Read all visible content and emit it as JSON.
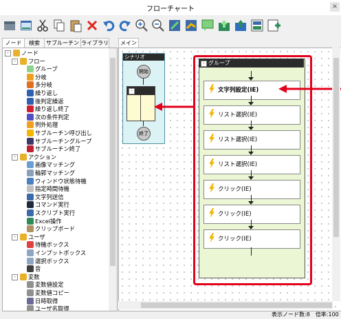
{
  "window": {
    "title": "フローチャート",
    "close": "×"
  },
  "tabs_left": [
    "ノード",
    "検索",
    "サブルーチン",
    "ライブラリ"
  ],
  "tab_main": "メイン",
  "tree": [
    {
      "label": "ノード",
      "icon": "folder-icon",
      "indent": 0,
      "expander": "-"
    },
    {
      "label": "フロー",
      "icon": "folder-icon",
      "indent": 1,
      "expander": "-"
    },
    {
      "label": "グループ",
      "icon": "group-icon",
      "indent": 2
    },
    {
      "label": "分岐",
      "icon": "branch-icon",
      "indent": 2
    },
    {
      "label": "多分岐",
      "icon": "multi-branch-icon",
      "indent": 2
    },
    {
      "label": "繰り返し",
      "icon": "loop-icon",
      "indent": 2
    },
    {
      "label": "後判定繰返",
      "icon": "loop-after-icon",
      "indent": 2
    },
    {
      "label": "繰り返し終了",
      "icon": "loop-end-icon",
      "indent": 2
    },
    {
      "label": "次の条件判定",
      "icon": "next-condition-icon",
      "indent": 2
    },
    {
      "label": "例外処理",
      "icon": "exception-icon",
      "indent": 2
    },
    {
      "label": "サブルーチン呼び出し",
      "icon": "subroutine-call-icon",
      "indent": 2
    },
    {
      "label": "サブルーチングループ",
      "icon": "subroutine-group-icon",
      "indent": 2
    },
    {
      "label": "サブルーチン終了",
      "icon": "subroutine-end-icon",
      "indent": 2
    },
    {
      "label": "アクション",
      "icon": "folder-icon",
      "indent": 1,
      "expander": "-"
    },
    {
      "label": "画像マッチング",
      "icon": "image-match-icon",
      "indent": 2
    },
    {
      "label": "輪郭マッチング",
      "icon": "contour-match-icon",
      "indent": 2
    },
    {
      "label": "ウィンドウ状態待機",
      "icon": "window-wait-icon",
      "indent": 2
    },
    {
      "label": "指定時間待機",
      "icon": "time-wait-icon",
      "indent": 2
    },
    {
      "label": "文字列送信",
      "icon": "send-text-icon",
      "indent": 2
    },
    {
      "label": "コマンド実行",
      "icon": "command-icon",
      "indent": 2
    },
    {
      "label": "スクリプト実行",
      "icon": "script-icon",
      "indent": 2
    },
    {
      "label": "Excel操作",
      "icon": "excel-icon",
      "indent": 2
    },
    {
      "label": "クリップボード",
      "icon": "clipboard-icon",
      "indent": 2
    },
    {
      "label": "ユーザ",
      "icon": "folder-icon",
      "indent": 1,
      "expander": "-"
    },
    {
      "label": "待機ボックス",
      "icon": "wait-box-icon",
      "indent": 2
    },
    {
      "label": "インプットボックス",
      "icon": "input-box-icon",
      "indent": 2
    },
    {
      "label": "選択ボックス",
      "icon": "select-box-icon",
      "indent": 2
    },
    {
      "label": "音",
      "icon": "sound-icon",
      "indent": 2
    },
    {
      "label": "変数",
      "icon": "folder-icon",
      "indent": 1,
      "expander": "-"
    },
    {
      "label": "変数値設定",
      "icon": "var-set-icon",
      "indent": 2
    },
    {
      "label": "変数値コピー",
      "icon": "var-copy-icon",
      "indent": 2
    },
    {
      "label": "日時取得",
      "icon": "datetime-icon",
      "indent": 2
    },
    {
      "label": "ユーザ名取得",
      "icon": "username-icon",
      "indent": 2
    }
  ],
  "scenario": {
    "title": "シナリオ",
    "start": "開始",
    "end": "終了",
    "group_toggle": "-"
  },
  "group": {
    "title": "グループ",
    "toggle": "-"
  },
  "group_items": [
    "文字列設定(IE)",
    "リスト選択(IE)",
    "リスト選択(IE)",
    "リスト選択(IE)",
    "クリック(IE)",
    "クリック(IE)",
    "クリック(IE)"
  ],
  "status": {
    "text": "表示ノード数:8　倍率:100"
  },
  "colors": {
    "highlight": "#e3001b",
    "group_fill": "#eaf6d4",
    "scenario_fill": "#dcf3f6",
    "bolt": "#f3b600"
  }
}
